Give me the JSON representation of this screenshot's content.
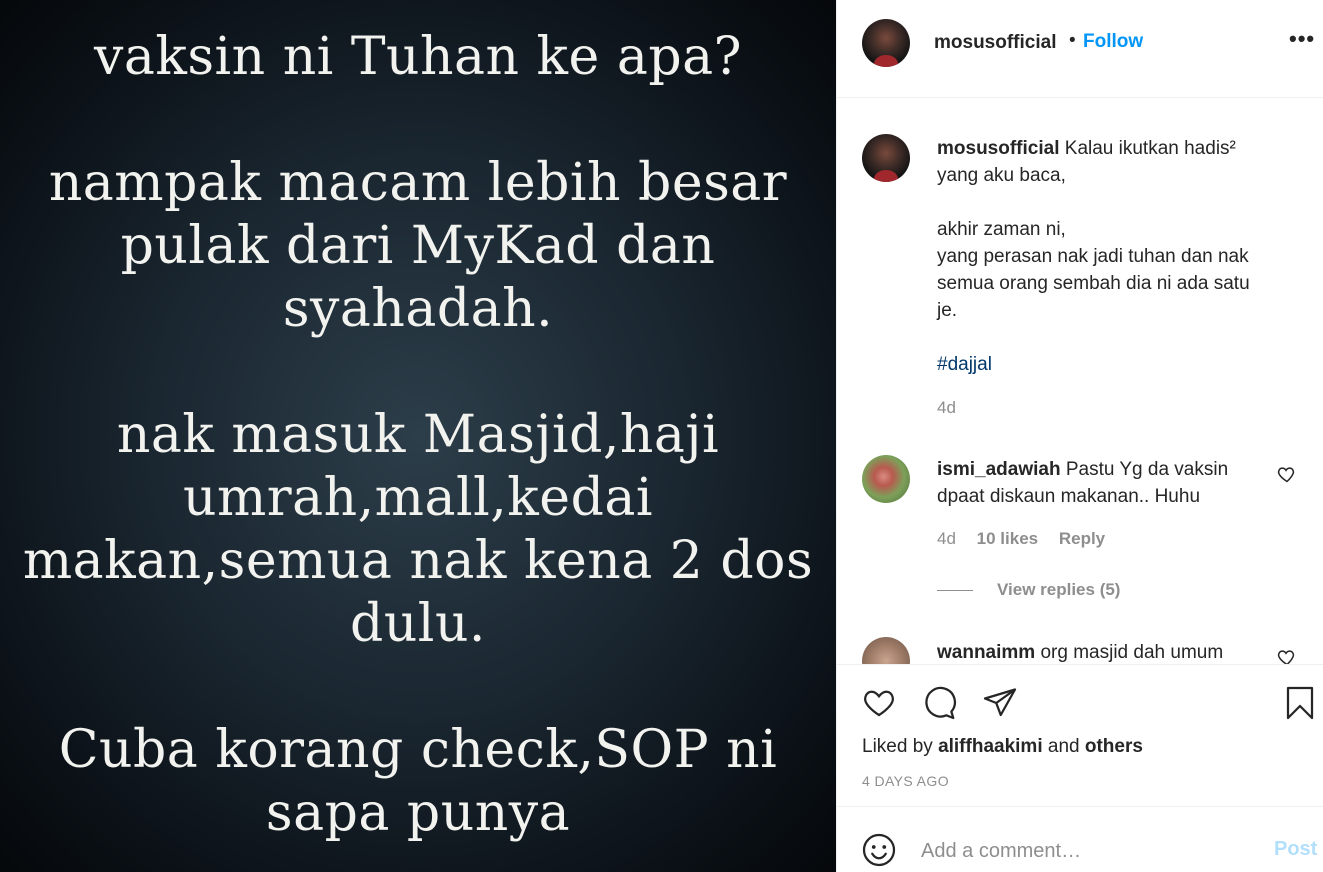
{
  "image": {
    "lines": [
      "vaksin ni Tuhan ke apa?",
      "",
      "nampak macam lebih besar",
      "pulak dari MyKad dan",
      "syahadah.",
      "",
      "nak masuk Masjid,haji",
      "umrah,mall,kedai",
      "makan,semua nak kena 2 dos",
      "dulu.",
      "",
      "Cuba korang check,SOP ni",
      "sapa punya"
    ]
  },
  "header": {
    "username": "mosusofficial",
    "separator": "•",
    "follow_label": "Follow",
    "more_label": "•••"
  },
  "caption": {
    "username": "mosusofficial",
    "line1": "Kalau ikutkan hadis²",
    "line2": "yang aku baca,",
    "line3": "akhir zaman ni,",
    "line4": "yang perasan nak jadi tuhan dan nak",
    "line5": "semua orang sembah dia ni ada satu",
    "line6": "je.",
    "hashtag": "#dajjal",
    "time": "4d"
  },
  "comment1": {
    "username": "ismi_adawiah",
    "text": "Pastu Yg da vaksin dpaat diskaun makanan.. Huhu",
    "time": "4d",
    "likes": "10 likes",
    "reply_label": "Reply",
    "view_replies": "View replies (5)"
  },
  "comment2": {
    "username": "wannaimm",
    "text": "org masjid dah umum"
  },
  "actions": {
    "liked_prefix": "Liked by",
    "liked_user": "aliffhaakimi",
    "liked_and": "and",
    "liked_others": "others",
    "timestamp": "4 DAYS AGO"
  },
  "add_comment": {
    "placeholder": "Add a comment…",
    "post_label": "Post"
  },
  "colors": {
    "accent": "#0095f6",
    "hashtag": "#00376b",
    "muted": "#8e8e8e",
    "post_disabled": "#b2dffc"
  }
}
